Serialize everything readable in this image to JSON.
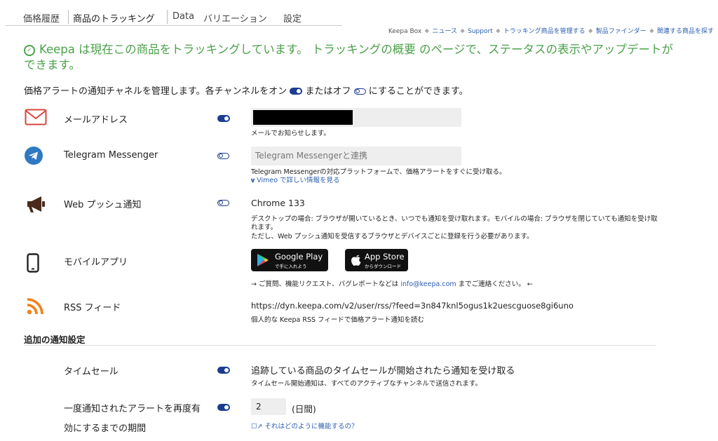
{
  "tabs": [
    {
      "label": "価格履歴"
    },
    {
      "label": "商品のトラッキング"
    },
    {
      "label": "Data"
    },
    {
      "label": "バリエーション"
    },
    {
      "label": "設定"
    }
  ],
  "toplinks": [
    "Keepa Box",
    "ニュース",
    "Support",
    "トラッキング商品を管理する",
    "製品ファインダー",
    "関連する商品を探す"
  ],
  "notice": {
    "text": "Keepa は現在この商品をトラッキングしています。 トラッキングの概要 のページで、ステータスの表示やアップデートができます。"
  },
  "intro": {
    "part1": "価格アラートの通知チャネルを管理します。各チャンネルをオン",
    "part2": "またはオフ",
    "part3": "にすることができます。"
  },
  "email": {
    "label": "メールアドレス",
    "enabled": true,
    "desc": "メールでお知らせします。"
  },
  "telegram": {
    "label": "Telegram Messenger",
    "enabled": false,
    "placeholder": "Telegram Messengerと連携",
    "desc": "Telegram Messengerの対応プラットフォームで、価格アラートをすぐに受け取る。",
    "link": "Vimeo で詳しい情報を見る"
  },
  "web_push": {
    "label": "Web プッシュ通知",
    "enabled": false,
    "browser": "Chrome 133",
    "desc1": "デスクトップの場合: ブラウザが開いているとき、いつでも通知を受け取れます。モバイルの場合: ブラウザを閉じていても通知を受け取れます。",
    "desc2": "ただし、Web プッシュ通知を受信するブラウザとデバイスごとに登録を行う必要があります。"
  },
  "mobile": {
    "label": "モバイルアプリ",
    "google_play": {
      "title": "Google Play",
      "sub": "で手に入れよう"
    },
    "app_store": {
      "title": "App Store",
      "sub": "からダウンロード"
    },
    "contact_pre": "→ ご質問、機能リクエスト、バグレポートなどは",
    "contact_email": "info@keepa.com",
    "contact_post": "までご連絡ください。 ←"
  },
  "rss": {
    "label": "RSS フィード",
    "url": "https://dyn.keepa.com/v2/user/rss/?feed=3n847knl5ogus1k2uescguose8gi6uno",
    "desc": "個人的な Keepa RSS フィードで価格アラート通知を読む"
  },
  "additional": {
    "title": "追加の通知設定",
    "lightning": {
      "label": "タイムセール",
      "enabled": true,
      "title": "追跡している商品のタイムセールが開始されたら通知を受け取る",
      "desc": "タイムセール開始通知は、すべてのアクティブなチャンネルで送信されます。"
    },
    "reactivate": {
      "label_line1": "一度通知されたアラートを再度有",
      "label_line2": "効にするまでの期間",
      "enabled": true,
      "value": "2",
      "unit": "(日間)",
      "link": "それはどのように機能するの？"
    }
  },
  "colors": {
    "accent": "#1a3d8f",
    "success": "#4aa14a",
    "link": "#2a5db0",
    "email_icon": "#d9453b",
    "rss_icon": "#f0811c",
    "telegram_icon": "#2f78c4"
  }
}
